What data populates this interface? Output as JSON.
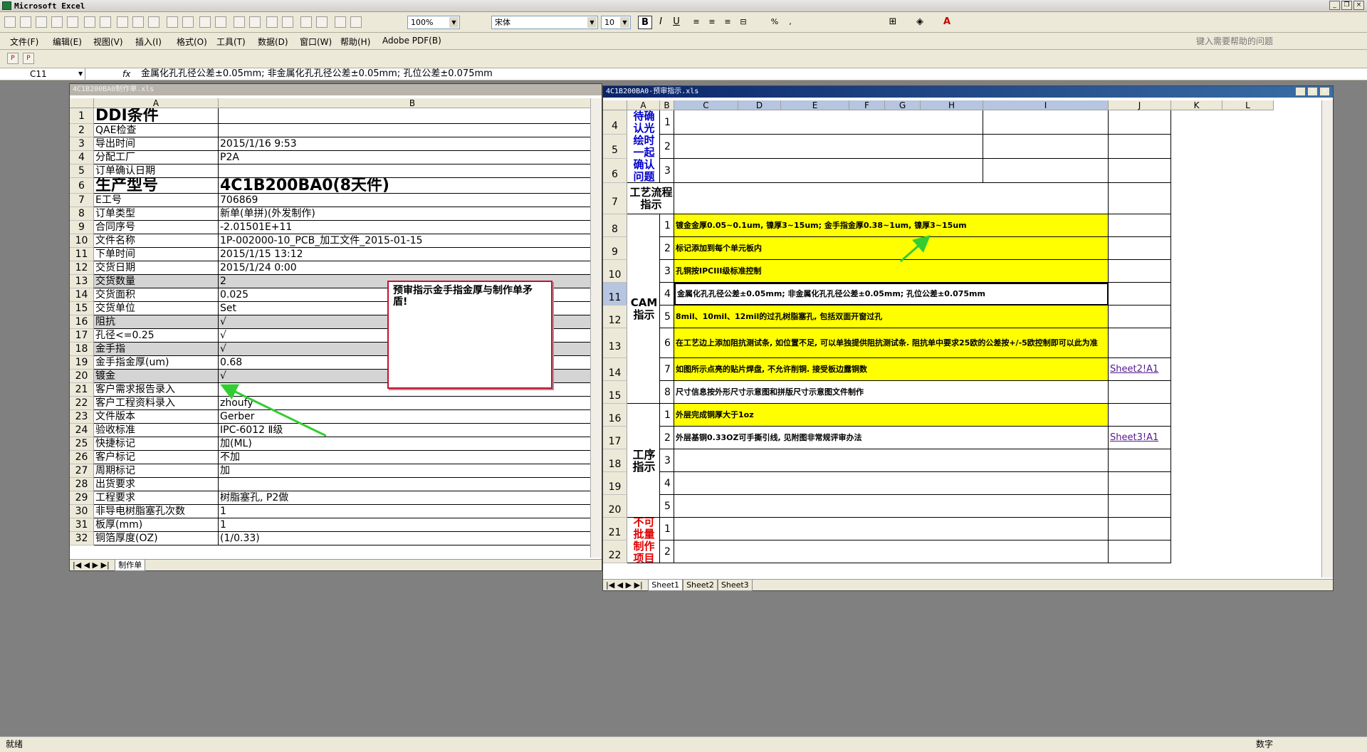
{
  "app": {
    "title": "Microsoft Excel"
  },
  "toolbar": {
    "zoom": "100%",
    "font": "宋体",
    "size": "10"
  },
  "menus": [
    "文件(F)",
    "编辑(E)",
    "视图(V)",
    "插入(I)",
    "格式(O)",
    "工具(T)",
    "数据(D)",
    "窗口(W)",
    "帮助(H)",
    "Adobe PDF(B)"
  ],
  "help_placeholder": "键入需要帮助的问题",
  "formula": {
    "cell": "C11",
    "fx": "fx",
    "content": "金属化孔孔径公差±0.05mm; 非金属化孔孔径公差±0.05mm; 孔位公差±0.075mm"
  },
  "win1": {
    "title": "4C1B200BA0制作单.xls",
    "cols": [
      "A",
      "B"
    ],
    "rows": [
      {
        "n": "1",
        "a": "DDI条件",
        "b": ""
      },
      {
        "n": "2",
        "a": "QAE检查",
        "b": ""
      },
      {
        "n": "3",
        "a": "导出时间",
        "b": "2015/1/16 9:53"
      },
      {
        "n": "4",
        "a": "分配工厂",
        "b": "P2A"
      },
      {
        "n": "5",
        "a": "订单确认日期",
        "b": ""
      },
      {
        "n": "6",
        "a": "生产型号",
        "b": "4C1B200BA0(8天件)"
      },
      {
        "n": "7",
        "a": "E工号",
        "b": "706869"
      },
      {
        "n": "8",
        "a": "订单类型",
        "b": "新单(单拼)(外发制作)"
      },
      {
        "n": "9",
        "a": "合同序号",
        "b": "-2.01501E+11"
      },
      {
        "n": "10",
        "a": "文件名称",
        "b": "1P-002000-10_PCB_加工文件_2015-01-15"
      },
      {
        "n": "11",
        "a": "下单时间",
        "b": "2015/1/15 13:12"
      },
      {
        "n": "12",
        "a": "交货日期",
        "b": "2015/1/24 0:00"
      },
      {
        "n": "13",
        "a": "交货数量",
        "b": "2"
      },
      {
        "n": "14",
        "a": "交货面积",
        "b": "0.025"
      },
      {
        "n": "15",
        "a": "交货单位",
        "b": "Set"
      },
      {
        "n": "16",
        "a": "阻抗",
        "b": "√"
      },
      {
        "n": "17",
        "a": "孔径<=0.25",
        "b": "√"
      },
      {
        "n": "18",
        "a": "金手指",
        "b": "√"
      },
      {
        "n": "19",
        "a": "金手指金厚(um)",
        "b": "0.68"
      },
      {
        "n": "20",
        "a": "镀金",
        "b": "√"
      },
      {
        "n": "21",
        "a": "客户需求报告录入",
        "b": ""
      },
      {
        "n": "22",
        "a": "客户工程资料录入",
        "b": "zhoufy"
      },
      {
        "n": "23",
        "a": "文件版本",
        "b": "Gerber"
      },
      {
        "n": "24",
        "a": "验收标准",
        "b": "IPC-6012 Ⅱ级"
      },
      {
        "n": "25",
        "a": "快捷标记",
        "b": "加(ML)"
      },
      {
        "n": "26",
        "a": "客户标记",
        "b": "不加"
      },
      {
        "n": "27",
        "a": "周期标记",
        "b": "加"
      },
      {
        "n": "28",
        "a": "出货要求",
        "b": ""
      },
      {
        "n": "29",
        "a": "工程要求",
        "b": "树脂塞孔, P2做"
      },
      {
        "n": "30",
        "a": "非导电树脂塞孔次数",
        "b": "1"
      },
      {
        "n": "31",
        "a": "板厚(mm)",
        "b": "1"
      },
      {
        "n": "32",
        "a": "铜箔厚度(OZ)",
        "b": "(1/0.33)"
      }
    ],
    "tab": "制作单",
    "comment": "预审指示金手指金厚与制作单矛盾!"
  },
  "win2": {
    "title": "4C1B200BA0-预审指示.xls",
    "cols": [
      "A",
      "B",
      "C",
      "D",
      "E",
      "F",
      "G",
      "H",
      "I",
      "J",
      "K",
      "L"
    ],
    "row_nums": [
      "4",
      "5",
      "6",
      "7",
      "8",
      "9",
      "10",
      "11",
      "12",
      "13",
      "14",
      "15",
      "16",
      "17",
      "18",
      "19",
      "20",
      "21",
      "22"
    ],
    "group_confirm": "待确认光绘时一起确认问题",
    "group_process": "工艺流程指示",
    "group_cam": "CAM指示",
    "group_proc": "工序指示",
    "group_nobatch": "不可批量制作项目",
    "confirm_b": [
      "1",
      "2",
      "3"
    ],
    "cam": [
      {
        "b": "1",
        "c": "镀金金厚0.05~0.1um, 镍厚3~15um; 金手指金厚0.38~1um, 镍厚3~15um",
        "y": true
      },
      {
        "b": "2",
        "c": "标记添加到每个单元板内",
        "y": true
      },
      {
        "b": "3",
        "c": "孔铜按IPCIII级标准控制",
        "y": true
      },
      {
        "b": "4",
        "c": "金属化孔孔径公差±0.05mm; 非金属化孔孔径公差±0.05mm; 孔位公差±0.075mm",
        "y": false
      },
      {
        "b": "5",
        "c": "8mil、10mil、12mil的过孔树脂塞孔, 包括双面开窗过孔",
        "y": true
      },
      {
        "b": "6",
        "c": "在工艺边上添加阻抗测试条, 如位置不足, 可以单独提供阻抗测试条. 阻抗单中要求25欧的公差按+/-5欧控制即可以此为准",
        "y": true
      },
      {
        "b": "7",
        "c": "如图所示点亮的贴片焊盘, 不允许削铜. 接受板边露铜数",
        "y": true,
        "j": "Sheet2!A1"
      },
      {
        "b": "8",
        "c": "尺寸信息按外形尺寸示意图和拼版尺寸示意图文件制作",
        "y": false
      }
    ],
    "proc": [
      {
        "b": "1",
        "c": "外层完成铜厚大于1oz",
        "y": true
      },
      {
        "b": "2",
        "c": "外层基铜0.33OZ可手撕引线, 见附图非常规评审办法",
        "y": false,
        "j": "Sheet3!A1"
      },
      {
        "b": "3",
        "c": ""
      },
      {
        "b": "4",
        "c": ""
      },
      {
        "b": "5",
        "c": ""
      }
    ],
    "nobatch_b": [
      "1",
      "2"
    ],
    "tabs": [
      "Sheet1",
      "Sheet2",
      "Sheet3"
    ]
  },
  "status": {
    "left": "就绪",
    "right": "数字"
  },
  "colors": {
    "yellow": "#ffff00",
    "red": "#c8102e",
    "arrow": "#33cc33"
  }
}
